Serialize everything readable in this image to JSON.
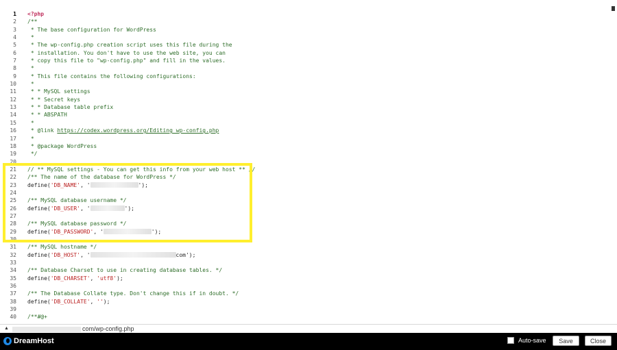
{
  "editor": {
    "lines": [
      {
        "n": "1",
        "segs": [
          {
            "t": "<?php",
            "c": "ph"
          }
        ]
      },
      {
        "n": "2",
        "segs": [
          {
            "t": "/**",
            "c": "cm"
          }
        ]
      },
      {
        "n": "3",
        "segs": [
          {
            "t": " * The base configuration for WordPress",
            "c": "cm"
          }
        ]
      },
      {
        "n": "4",
        "segs": [
          {
            "t": " *",
            "c": "cm"
          }
        ]
      },
      {
        "n": "5",
        "segs": [
          {
            "t": " * The wp-config.php creation script uses this file during the",
            "c": "cm"
          }
        ]
      },
      {
        "n": "6",
        "segs": [
          {
            "t": " * installation. You don't have to use the web site, you can",
            "c": "cm"
          }
        ]
      },
      {
        "n": "7",
        "segs": [
          {
            "t": " * copy this file to \"wp-config.php\" and fill in the values.",
            "c": "cm"
          }
        ]
      },
      {
        "n": "8",
        "segs": [
          {
            "t": " *",
            "c": "cm"
          }
        ]
      },
      {
        "n": "9",
        "segs": [
          {
            "t": " * This file contains the following configurations:",
            "c": "cm"
          }
        ]
      },
      {
        "n": "10",
        "segs": [
          {
            "t": " *",
            "c": "cm"
          }
        ]
      },
      {
        "n": "11",
        "segs": [
          {
            "t": " * * MySQL settings",
            "c": "cm"
          }
        ]
      },
      {
        "n": "12",
        "segs": [
          {
            "t": " * * Secret keys",
            "c": "cm"
          }
        ]
      },
      {
        "n": "13",
        "segs": [
          {
            "t": " * * Database table prefix",
            "c": "cm"
          }
        ]
      },
      {
        "n": "14",
        "segs": [
          {
            "t": " * * ABSPATH",
            "c": "cm"
          }
        ]
      },
      {
        "n": "15",
        "segs": [
          {
            "t": " *",
            "c": "cm"
          }
        ]
      },
      {
        "n": "16",
        "segs": [
          {
            "t": " * @link ",
            "c": "cm"
          },
          {
            "t": "https://codex.wordpress.org/Editing_wp-config.php",
            "c": "link"
          }
        ]
      },
      {
        "n": "17",
        "segs": [
          {
            "t": " *",
            "c": "cm"
          }
        ]
      },
      {
        "n": "18",
        "segs": [
          {
            "t": " * @package WordPress",
            "c": "cm"
          }
        ]
      },
      {
        "n": "19",
        "segs": [
          {
            "t": " */",
            "c": "cm"
          }
        ]
      },
      {
        "n": "20",
        "segs": []
      },
      {
        "n": "21",
        "segs": [
          {
            "t": "// ** MySQL settings - You can get this info from your web host ** //",
            "c": "cm"
          }
        ]
      },
      {
        "n": "22",
        "segs": [
          {
            "t": "/** The name of the database for WordPress */",
            "c": "cm"
          }
        ]
      },
      {
        "n": "23",
        "segs": [
          {
            "t": "define(",
            "c": "df"
          },
          {
            "t": "'DB_NAME'",
            "c": "str"
          },
          {
            "t": ", '",
            "c": "df"
          },
          {
            "r": "70"
          },
          {
            "t": "');",
            "c": "df"
          }
        ]
      },
      {
        "n": "24",
        "segs": []
      },
      {
        "n": "25",
        "segs": [
          {
            "t": "/** MySQL database username */",
            "c": "cm"
          }
        ]
      },
      {
        "n": "26",
        "segs": [
          {
            "t": "define(",
            "c": "df"
          },
          {
            "t": "'DB_USER'",
            "c": "str"
          },
          {
            "t": ", '",
            "c": "df"
          },
          {
            "r": "50"
          },
          {
            "t": "');",
            "c": "df"
          }
        ]
      },
      {
        "n": "27",
        "segs": []
      },
      {
        "n": "28",
        "segs": [
          {
            "t": "/** MySQL database password */",
            "c": "cm"
          }
        ]
      },
      {
        "n": "29",
        "segs": [
          {
            "t": "define(",
            "c": "df"
          },
          {
            "t": "'DB_PASSWORD'",
            "c": "str"
          },
          {
            "t": ", '",
            "c": "df"
          },
          {
            "r": "70"
          },
          {
            "t": "');",
            "c": "df"
          }
        ]
      },
      {
        "n": "30",
        "segs": []
      },
      {
        "n": "31",
        "segs": [
          {
            "t": "/** MySQL hostname */",
            "c": "cm"
          }
        ]
      },
      {
        "n": "32",
        "segs": [
          {
            "t": "define(",
            "c": "df"
          },
          {
            "t": "'DB_HOST'",
            "c": "str"
          },
          {
            "t": ", '",
            "c": "df"
          },
          {
            "r": "125"
          },
          {
            "t": "com');",
            "c": "df"
          }
        ]
      },
      {
        "n": "33",
        "segs": []
      },
      {
        "n": "34",
        "segs": [
          {
            "t": "/** Database Charset to use in creating database tables. */",
            "c": "cm"
          }
        ]
      },
      {
        "n": "35",
        "segs": [
          {
            "t": "define(",
            "c": "df"
          },
          {
            "t": "'DB_CHARSET'",
            "c": "str"
          },
          {
            "t": ", ",
            "c": "df"
          },
          {
            "t": "'utf8'",
            "c": "str"
          },
          {
            "t": ");",
            "c": "df"
          }
        ]
      },
      {
        "n": "36",
        "segs": []
      },
      {
        "n": "37",
        "segs": [
          {
            "t": "/** The Database Collate type. Don't change this if in doubt. */",
            "c": "cm"
          }
        ]
      },
      {
        "n": "38",
        "segs": [
          {
            "t": "define(",
            "c": "df"
          },
          {
            "t": "'DB_COLLATE'",
            "c": "str"
          },
          {
            "t": ", ",
            "c": "df"
          },
          {
            "t": "''",
            "c": "str"
          },
          {
            "t": ");",
            "c": "df"
          }
        ]
      },
      {
        "n": "39",
        "segs": []
      },
      {
        "n": "40",
        "segs": [
          {
            "t": "/**#@+",
            "c": "cm"
          }
        ]
      }
    ]
  },
  "status": {
    "path": "com/wp-config.php"
  },
  "footer": {
    "brand": "DreamHost",
    "autosave_label": "Auto-save",
    "save_label": "Save",
    "close_label": "Close"
  }
}
